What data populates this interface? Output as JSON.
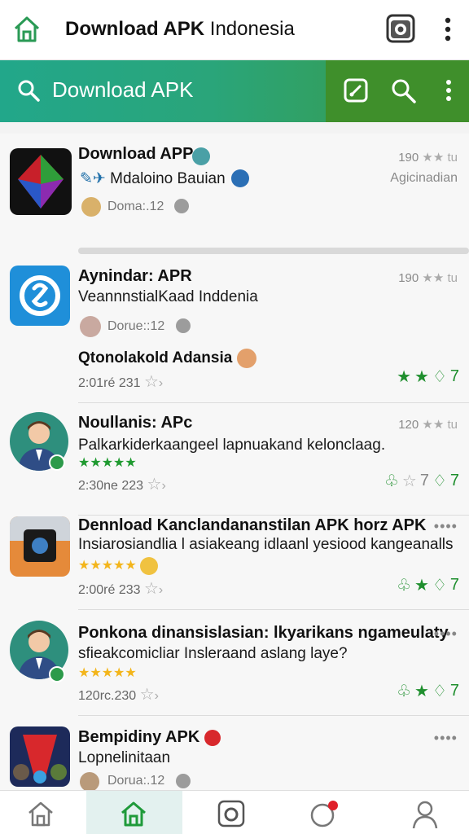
{
  "header": {
    "title_bold": "Download APK",
    "title_rest": " Indonesia"
  },
  "search": {
    "placeholder": "Download APK"
  },
  "items": [
    {
      "name": "Download APP",
      "sub": "Mdaloino Bauian",
      "meta": "Doma:.12",
      "count": "190",
      "side": "Agicinadian"
    },
    {
      "name": "Aynindar: APR",
      "sub": "VeannnstialKaad Inddenia",
      "meta": "Dorue::12",
      "count": "190",
      "extra_title": "Qtonolakold Adansia",
      "date": "2:01ré 231",
      "score": "7"
    },
    {
      "name": "Noullanis: APc",
      "sub": "Palkarkiderkaangeel lapnuakand kelonclaag.",
      "count": "120",
      "date": "2:30ne 223",
      "score1": "7",
      "score2": "7"
    },
    {
      "name": "Dennload Kanclandananstilan APK horz APK",
      "sub": "Insiarosiandlia l asiakeang idlaanl yesiood kangeanalls",
      "date": "2:00ré 233",
      "score": "7"
    },
    {
      "name": "Ponkona dinansislasian: lkyarikans ngameulaty",
      "sub": "sfieakcomicliar Insleraand aslang laye?",
      "date": "120rc.230",
      "score": "7"
    },
    {
      "name": "Bempidiny APK",
      "sub": "Lopnelinitaan",
      "meta": "Dorua:.12"
    }
  ],
  "colors": {
    "accent": "#2aa57a",
    "accent_dark": "#3f8f2b",
    "star_green": "#1f8f2e",
    "star_gold": "#f3b51b"
  },
  "icons": [
    "home-icon",
    "camera-icon",
    "more-vertical-icon",
    "search-icon",
    "edit-icon",
    "like-icon",
    "share-icon",
    "notification-icon",
    "profile-icon"
  ]
}
